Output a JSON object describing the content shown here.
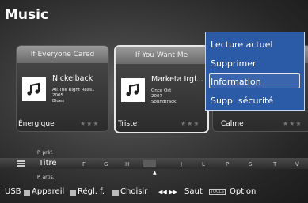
{
  "title": "Music",
  "cards": [
    {
      "header": "If Everyone Cared",
      "artist": "Nickelback",
      "line1": "All The Right Reas..",
      "line2": "2005",
      "line3": "Blues"
    },
    {
      "header": "If You Want Me",
      "artist": "Marketa Irgl...",
      "line1": "Once Ost",
      "line2": "2007",
      "line3": "Soundtrack"
    },
    {
      "header": "",
      "artist": "",
      "line1": "",
      "line2": "",
      "line3": ""
    }
  ],
  "moods": [
    "Énergique",
    "Triste",
    "Calme"
  ],
  "stars": "★★★",
  "menu": [
    "Lecture actuel",
    "Supprimer",
    "Information",
    "Supp. sécurité"
  ],
  "sort": {
    "prev": "P. préf.",
    "label": "Titre",
    "next": "P. artis.",
    "letters": [
      "F",
      "G",
      "H",
      "J",
      "L",
      "P",
      "S",
      "T",
      "V"
    ],
    "current_marker": "▲"
  },
  "footer": {
    "usb": "USB",
    "appareil": "Appareil",
    "regl": "Régl. f.",
    "choisir": "Choisir",
    "saut_arrows": "◀◀ ▶▶",
    "saut": "Saut",
    "tools": "TOOLS",
    "option": "Option"
  }
}
